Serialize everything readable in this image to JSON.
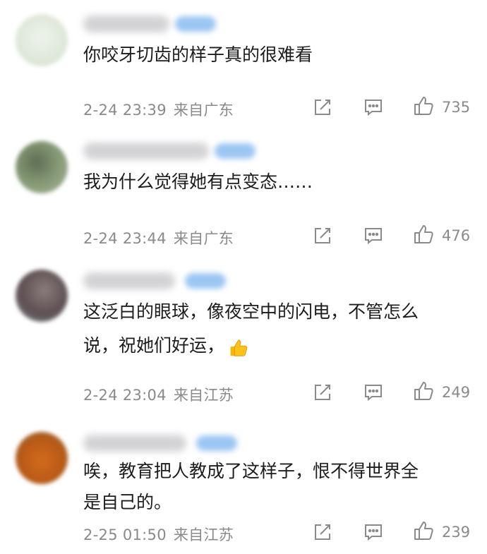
{
  "comments": [
    {
      "text": "你咬牙切齿的样子真的很难看",
      "time": "2-24 23:39",
      "location": "来自广东",
      "likes": "735",
      "avatar_color": "#e3ebe0"
    },
    {
      "text": "我为什么觉得她有点变态……",
      "time": "2-24 23:44",
      "location": "来自广东",
      "likes": "476",
      "avatar_color": "#7e9070"
    },
    {
      "text_line1": "这泛白的眼球，像夜空中的闪电，不管怎么",
      "text_line2": "说，祝她们好运，",
      "emoji": "thumbs-up-emoji",
      "time": "2-24 23:04",
      "location": "来自江苏",
      "likes": "249",
      "avatar_color": "#6e5f60"
    },
    {
      "text_line1": "唉，教育把人教成了这样子，恨不得世界全",
      "text_line2": "是自己的。",
      "time": "2-25 01:50",
      "location": "来自江苏",
      "likes": "239",
      "avatar_color": "#c8641e"
    }
  ],
  "icons": {
    "share": "share-icon",
    "reply": "comment-icon",
    "like": "thumbs-up-icon"
  },
  "colors": {
    "meta": "#8a8a8a",
    "badge": "#9cc6f2"
  }
}
